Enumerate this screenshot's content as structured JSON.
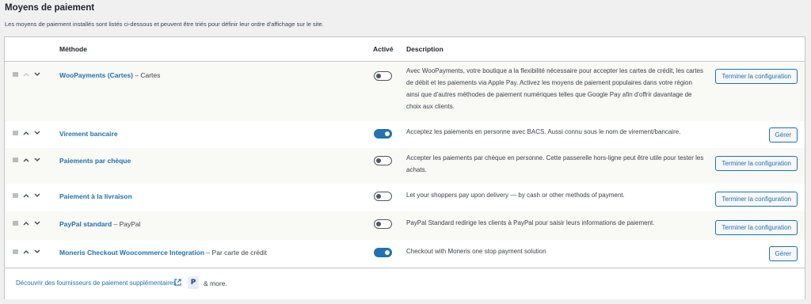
{
  "page": {
    "title": "Moyens de paiement",
    "description": "Les moyens de paiement installés sont listés ci-dessous et peuvent être triés pour définir leur ordre d'affichage sur le site."
  },
  "columns": {
    "method": "Méthode",
    "enabled": "Activé",
    "description": "Description"
  },
  "gateways": [
    {
      "name": "WooPayments (Cartes)",
      "suffix": " – Cartes",
      "enabled": false,
      "description": "Avec WooPayments, votre boutique a la flexibilité nécessaire pour accepter les cartes de crédit, les cartes de débit et les paiements via Apple Pay. Activez les moyens de paiement populaires dans votre région ainsi que d'autres méthodes de paiement numériques telles que Google Pay afin d'offrir davantage de choix aux clients.",
      "action": "Terminer la configuration"
    },
    {
      "name": "Virement bancaire",
      "suffix": "",
      "enabled": true,
      "description": "Acceptez les paiements en personne avec BACS. Aussi connu sous le nom de virement/bancaire.",
      "action": "Gérer"
    },
    {
      "name": "Paiements par chèque",
      "suffix": "",
      "enabled": false,
      "description": "Accepter les paiements par chèque en personne. Cette passerelle hors-ligne peut être utile pour tester les achats.",
      "action": "Terminer la configuration"
    },
    {
      "name": "Paiement à la livraison",
      "suffix": "",
      "enabled": false,
      "description": "Let your shoppers pay upon delivery — by cash or other methods of payment.",
      "action": "Terminer la configuration"
    },
    {
      "name": "PayPal standard",
      "suffix": " – PayPal",
      "enabled": false,
      "description": "PayPal Standard redirige les clients à PayPal pour saisir leurs informations de paiement.",
      "action": "Terminer la configuration"
    },
    {
      "name": "Moneris Checkout Woocommerce Integration",
      "suffix": " – Par carte de crédit",
      "enabled": true,
      "description": "Checkout with Moneris one stop payment solution",
      "action": "Gérer"
    }
  ],
  "footer": {
    "link": "Découvrir des fournisseurs de paiement supplémentaires",
    "more": "& more."
  },
  "colors": {
    "accent": "#2271b1",
    "background": "#f0f0f1",
    "toggle_off": "#50575e"
  },
  "icons": [
    "drag-handle-icon",
    "chevron-up-icon",
    "chevron-down-icon",
    "external-link-icon",
    "paypal-icon"
  ]
}
